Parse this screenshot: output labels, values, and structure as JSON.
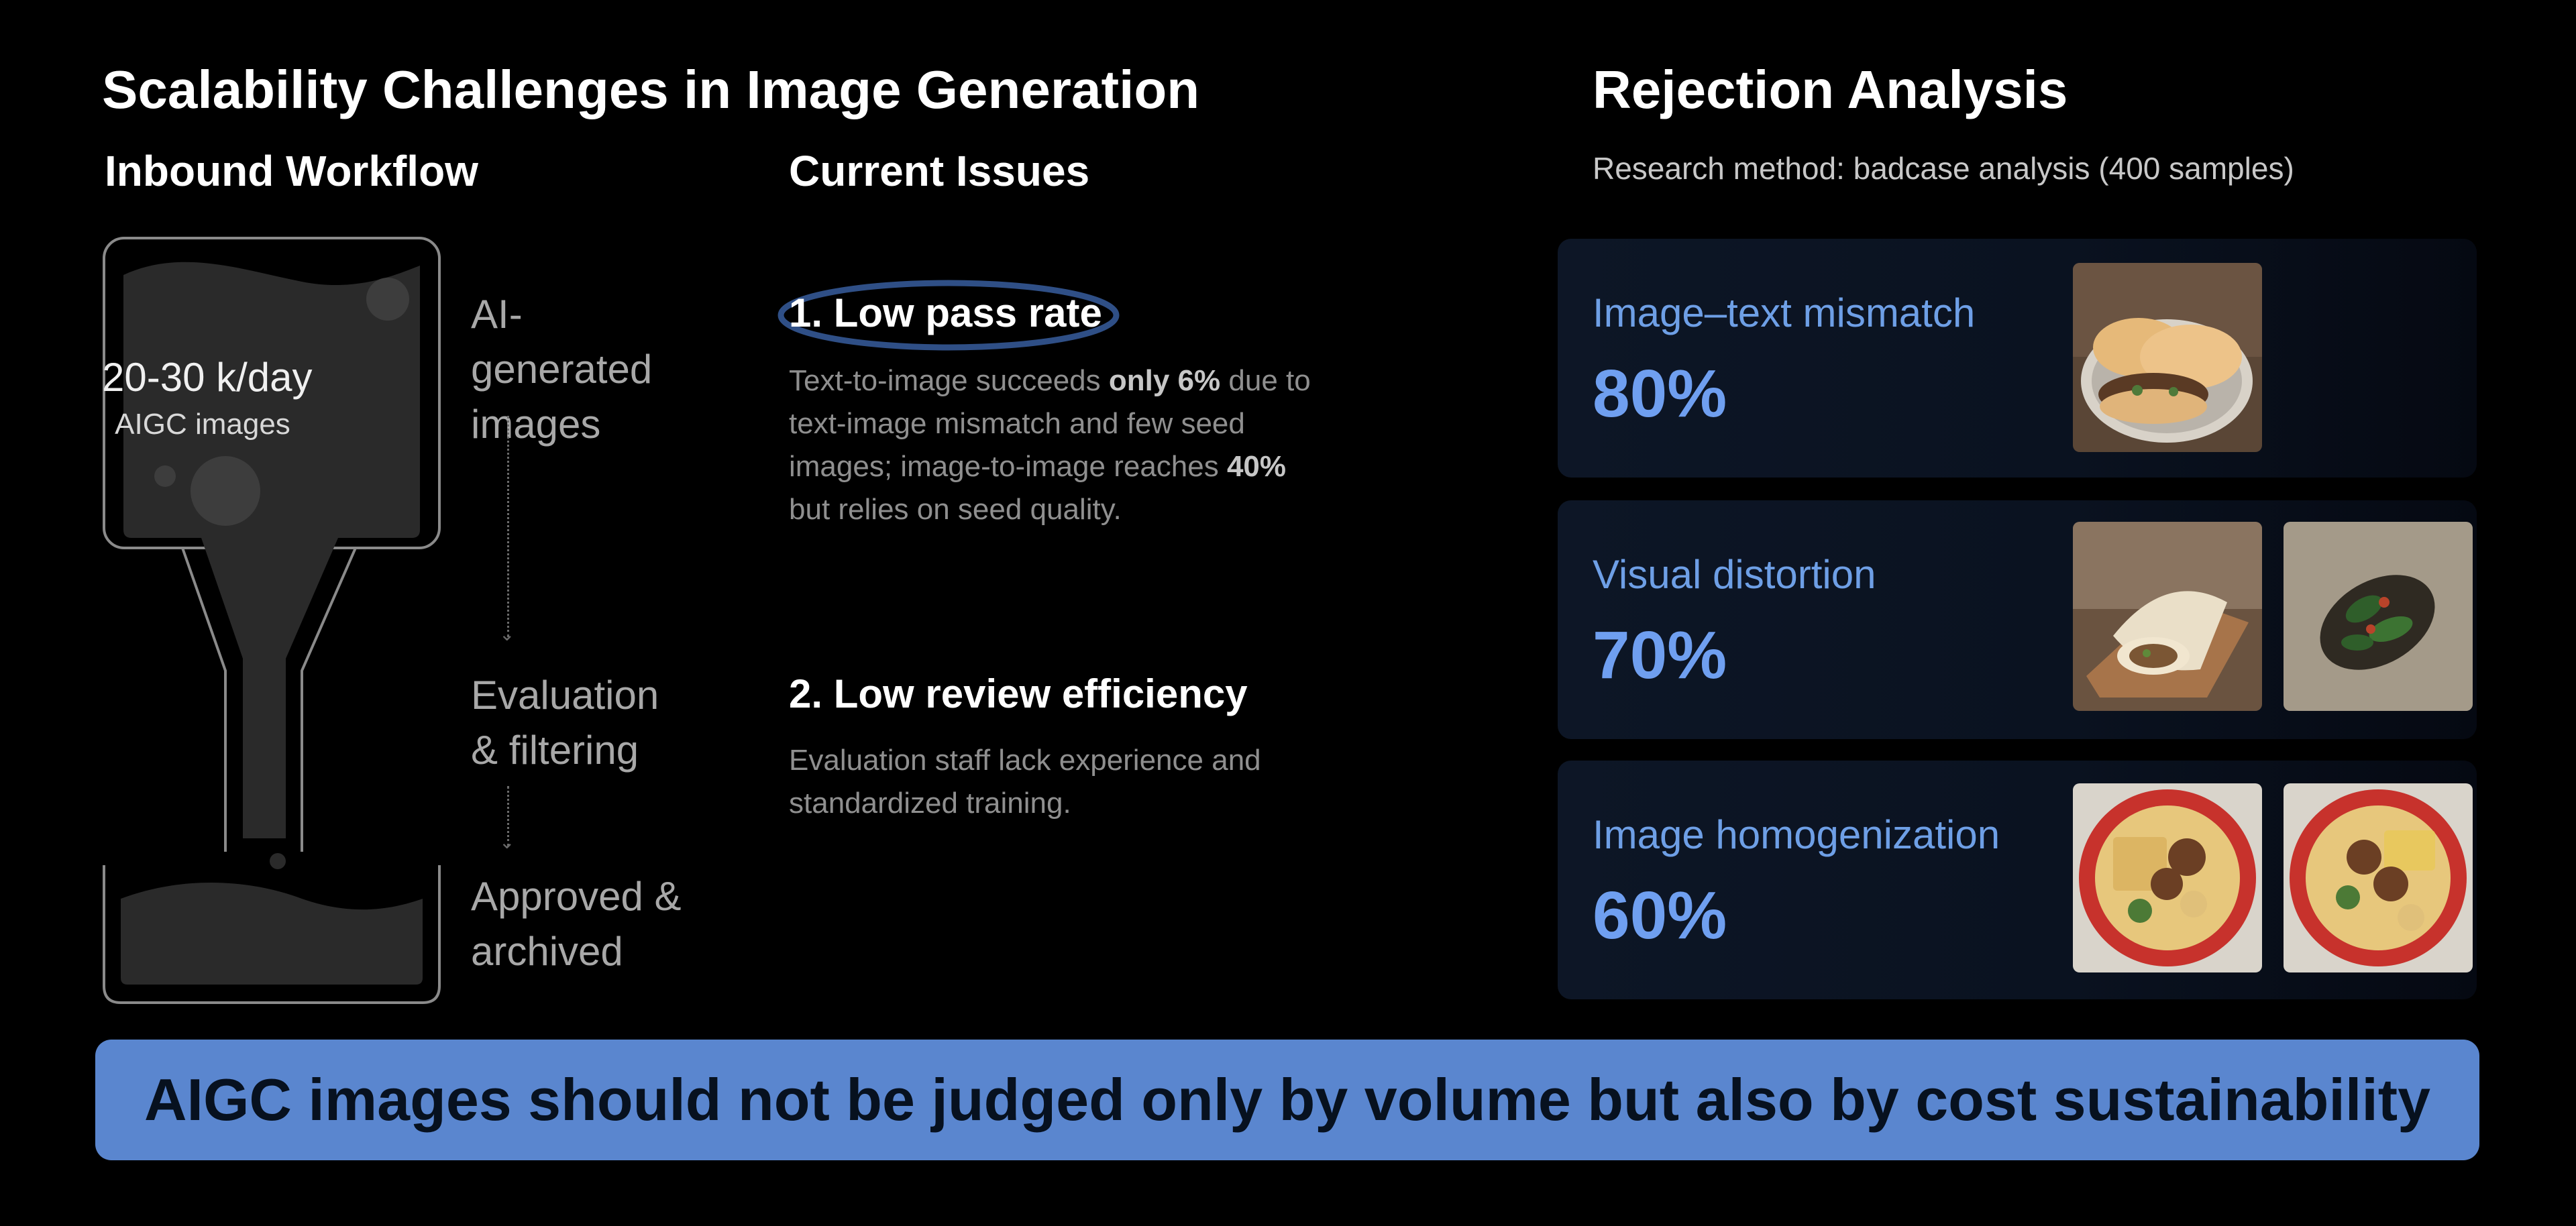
{
  "title": "Scalability Challenges in Image Generation",
  "inbound": {
    "heading": "Inbound Workflow",
    "funnel_value": "20-30 k/day",
    "funnel_unit": "AIGC images",
    "stages": [
      "AI-generated images",
      "Evaluation & filtering",
      "Approved & archived"
    ]
  },
  "issues": {
    "heading": "Current Issues",
    "items": [
      {
        "title": "1. Low pass rate",
        "body_parts": [
          {
            "text": "Text-to-image succeeds ",
            "bold": false
          },
          {
            "text": "only 6%",
            "bold": true
          },
          {
            "text": " due to text-image mismatch and few seed images; image-to-image reaches ",
            "bold": false
          },
          {
            "text": "40%",
            "bold": true
          },
          {
            "text": " but relies on seed quality.",
            "bold": false
          }
        ]
      },
      {
        "title": "2. Low review efficiency",
        "body_parts": [
          {
            "text": "Evaluation staff lack experience and standardized training.",
            "bold": false
          }
        ]
      }
    ]
  },
  "rejection": {
    "title": "Rejection Analysis",
    "subtitle": "Research method: badcase analysis (400 samples)",
    "cards": [
      {
        "label": "Image–text mismatch",
        "percent": "80%",
        "value": 80,
        "thumbs": [
          "flatbread-sandwich-photo"
        ]
      },
      {
        "label": "Visual distortion",
        "percent": "70%",
        "value": 70,
        "thumbs": [
          "wrap-sandwich-photo",
          "greens-dish-photo"
        ]
      },
      {
        "label": "Image homogenization",
        "percent": "60%",
        "value": 60,
        "thumbs": [
          "noodle-bowl-photo",
          "noodle-bowl-photo"
        ]
      }
    ]
  },
  "banner": "AIGC images should not be judged only by volume but also by cost sustainability",
  "colors": {
    "accent_blue": "#6f9ff0",
    "banner_blue": "#5a86cf",
    "highlight_ring": "#2f4f86"
  }
}
